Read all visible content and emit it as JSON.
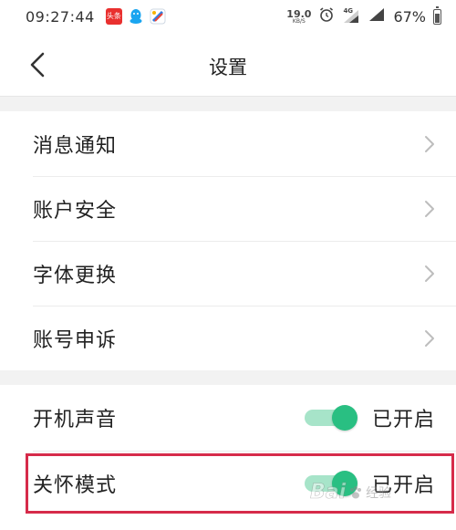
{
  "status_bar": {
    "time": "09:27:44",
    "apps": [
      "toutiao-app-icon",
      "qq-app-icon",
      "browser-app-icon"
    ],
    "toutiao_badge": "头条",
    "net_speed": "19.0",
    "net_speed_unit": "KB/S",
    "signal_label": "4G",
    "battery": "67%"
  },
  "nav": {
    "back_icon": "chevron-left-icon",
    "title": "设置"
  },
  "settings_group_1": [
    {
      "label": "消息通知"
    },
    {
      "label": "账户安全"
    },
    {
      "label": "字体更换"
    },
    {
      "label": "账号申诉"
    }
  ],
  "settings_group_2": [
    {
      "label": "开机声音",
      "status": "已开启",
      "on": true
    },
    {
      "label": "关怀模式",
      "status": "已开启",
      "on": true
    }
  ],
  "watermark": {
    "brand": "Bai",
    "sub": "经验"
  },
  "colors": {
    "toggle_on": "#29bf82",
    "toggle_track": "#a7e4c9",
    "highlight": "#d62b4a"
  }
}
